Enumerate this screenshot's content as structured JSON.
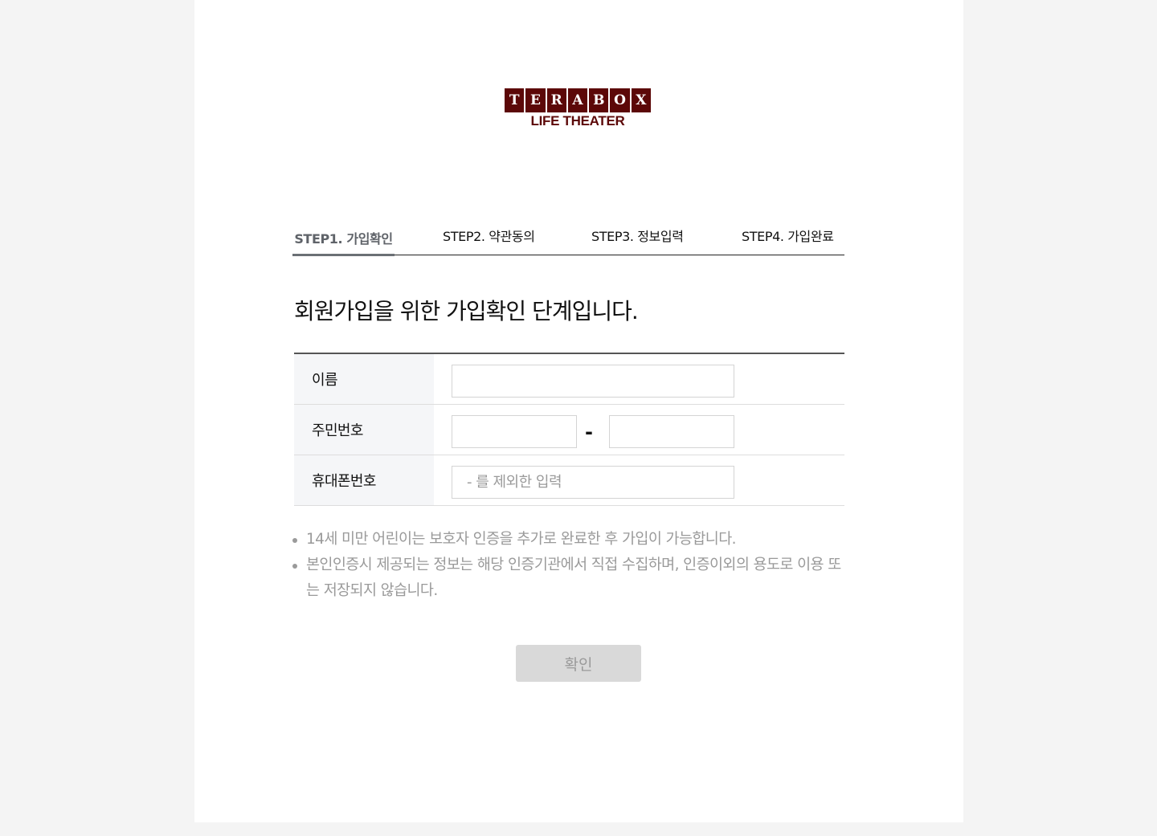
{
  "logo": {
    "letters": [
      "T",
      "E",
      "R",
      "A",
      "B",
      "O",
      "X"
    ],
    "subtitle": "LIFE THEATER",
    "brand_color": "#5c0808"
  },
  "steps": [
    {
      "label": "STEP1. 가입확인",
      "active": true
    },
    {
      "label": "STEP2. 약관동의",
      "active": false
    },
    {
      "label": "STEP3. 정보입력",
      "active": false
    },
    {
      "label": "STEP4. 가입완료",
      "active": false
    }
  ],
  "heading": "회원가입을 위한 가입확인 단계입니다.",
  "form": {
    "name": {
      "label": "이름",
      "value": "",
      "placeholder": ""
    },
    "resident_number": {
      "label": "주민번호",
      "first_value": "",
      "second_value": "",
      "separator": "-"
    },
    "phone": {
      "label": "휴대폰번호",
      "value": "",
      "placeholder": "- 를 제외한 입력"
    }
  },
  "notes": [
    "14세 미만 어린이는 보호자 인증을 추가로 완료한 후 가입이 가능합니다.",
    "본인인증시 제공되는 정보는 해당 인증기관에서 직접 수집하며, 인증이외의 용도로 이용 또는 저장되지 않습니다."
  ],
  "confirm_button": {
    "label": "확인",
    "enabled": false
  },
  "colors": {
    "page_background": "#f4f4f4",
    "active_step": "#5f6369",
    "disabled_button": "#d9d9d9"
  }
}
